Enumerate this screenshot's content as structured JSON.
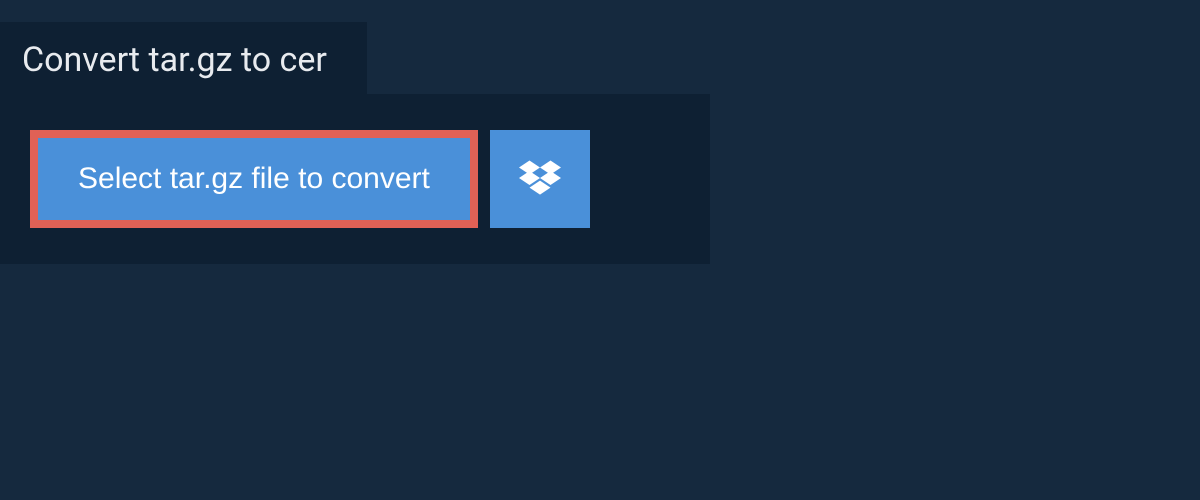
{
  "tab": {
    "title": "Convert tar.gz to cer"
  },
  "panel": {
    "select_button_label": "Select tar.gz file to convert",
    "dropbox_icon": "dropbox-icon"
  },
  "colors": {
    "background": "#15293e",
    "panel": "#0e2033",
    "button": "#4a90d9",
    "button_border": "#e06156",
    "text_light": "#e8ebef",
    "text_white": "#ffffff"
  }
}
